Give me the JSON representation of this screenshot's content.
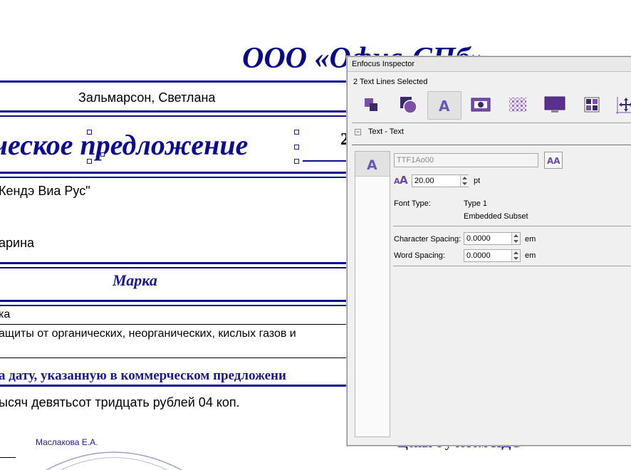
{
  "document": {
    "company": "ООО «Офис-СПб»",
    "person": "Зальмарсон, Светлана",
    "title": "ческое предложение",
    "title_digit": "2",
    "client": "Кендэ Виа Рус\"",
    "contact": "арина",
    "brand_heading": "Марка",
    "row1": "ка",
    "row2": "ащиты от органических, неорганических, кислых газов и",
    "date_note": "а дату, указанную в коммерческом предложени",
    "amount_words": "ысяч девятьсот тридцать рублей 04 коп.",
    "signer": "Маслакова Е.А.",
    "vat_note": "Цены с учетом НДС"
  },
  "inspector": {
    "title": "Enfocus Inspector",
    "selection": "2 Text Lines Selected",
    "toolbar": [
      "position-icon",
      "shape-icon",
      "text-icon",
      "image-icon",
      "fill-icon",
      "display-icon",
      "layout-icon",
      "move-icon"
    ],
    "section": "Text - Text",
    "font_name": "TTF1Ao00",
    "font_size": "20.00",
    "font_size_unit": "pt",
    "font_type_label": "Font Type:",
    "font_type_value": "Type 1",
    "font_embed": "Embedded Subset",
    "char_spacing_label": "Character Spacing:",
    "char_spacing_value": "0.0000",
    "char_spacing_unit": "em",
    "word_spacing_label": "Word Spacing:",
    "word_spacing_value": "0.0000",
    "word_spacing_unit": "em",
    "accent": "#7b4fa8"
  }
}
